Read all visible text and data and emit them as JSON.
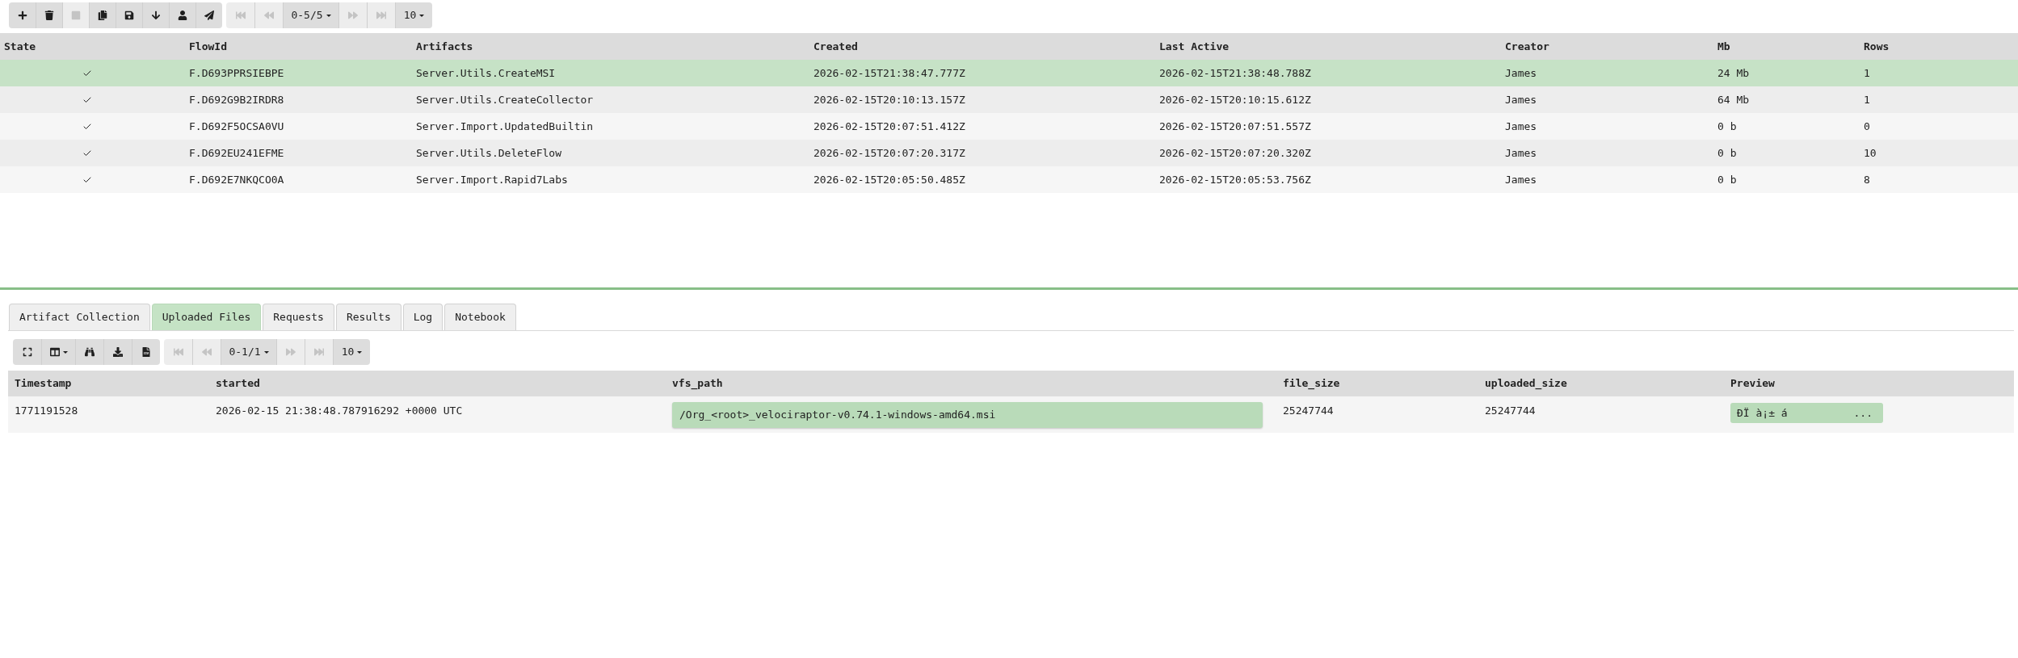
{
  "toolbar": {
    "buttons": [
      {
        "kind": "add",
        "disabled": false
      },
      {
        "kind": "delete",
        "disabled": false
      },
      {
        "kind": "stop",
        "disabled": true
      },
      {
        "kind": "copy",
        "disabled": false
      },
      {
        "kind": "save",
        "disabled": false
      },
      {
        "kind": "download_arrow",
        "disabled": false
      },
      {
        "kind": "user",
        "disabled": false
      },
      {
        "kind": "send",
        "disabled": false
      }
    ],
    "pager": [
      {
        "kind": "first",
        "disabled": true
      },
      {
        "kind": "prev",
        "disabled": true
      },
      {
        "kind": "range",
        "label": "0-5/5",
        "disabled": false
      },
      {
        "kind": "next",
        "disabled": true
      },
      {
        "kind": "last",
        "disabled": true
      },
      {
        "kind": "page_size",
        "label": "10",
        "disabled": false
      }
    ]
  },
  "flows": {
    "columns": [
      "State",
      "FlowId",
      "Artifacts",
      "Created",
      "Last Active",
      "Creator",
      "Mb",
      "Rows"
    ],
    "rows": [
      {
        "selected": true,
        "cells": [
          {
            "kind": "state",
            "completed": true
          },
          "F.D693PPRSIEBPE",
          "Server.Utils.CreateMSI",
          "2026-02-15T21:38:47.777Z",
          "2026-02-15T21:38:48.788Z",
          "James",
          "24 Mb",
          "1"
        ]
      },
      {
        "selected": false,
        "cells": [
          {
            "kind": "state",
            "completed": true
          },
          "F.D692G9B2IRDR8",
          "Server.Utils.CreateCollector",
          "2026-02-15T20:10:13.157Z",
          "2026-02-15T20:10:15.612Z",
          "James",
          "64 Mb",
          "1"
        ]
      },
      {
        "selected": false,
        "cells": [
          {
            "kind": "state",
            "completed": true
          },
          "F.D692F5OCSA0VU",
          "Server.Import.UpdatedBuiltin",
          "2026-02-15T20:07:51.412Z",
          "2026-02-15T20:07:51.557Z",
          "James",
          "0 b",
          "0"
        ]
      },
      {
        "selected": false,
        "cells": [
          {
            "kind": "state",
            "completed": true
          },
          "F.D692EU241EFME",
          "Server.Utils.DeleteFlow",
          "2026-02-15T20:07:20.317Z",
          "2026-02-15T20:07:20.320Z",
          "James",
          "0 b",
          "10"
        ]
      },
      {
        "selected": false,
        "cells": [
          {
            "kind": "state",
            "completed": true
          },
          "F.D692E7NKQCO0A",
          "Server.Import.Rapid7Labs",
          "2026-02-15T20:05:50.485Z",
          "2026-02-15T20:05:53.756Z",
          "James",
          "0 b",
          "8"
        ]
      }
    ]
  },
  "detail": {
    "tabs": [
      {
        "label": "Artifact Collection",
        "selected": false
      },
      {
        "label": "Uploaded Files",
        "selected": true
      },
      {
        "label": "Requests",
        "selected": false
      },
      {
        "label": "Results",
        "selected": false
      },
      {
        "label": "Log",
        "selected": false
      },
      {
        "label": "Notebook",
        "selected": false
      }
    ],
    "toolbar": {
      "buttons": [
        {
          "kind": "expand",
          "disabled": false
        },
        {
          "kind": "columns",
          "disabled": false
        },
        {
          "kind": "search",
          "disabled": false
        },
        {
          "kind": "download",
          "disabled": false
        },
        {
          "kind": "csv",
          "disabled": false
        }
      ],
      "pager": [
        {
          "kind": "first",
          "disabled": true
        },
        {
          "kind": "prev",
          "disabled": true
        },
        {
          "kind": "range",
          "label": "0-1/1",
          "disabled": false
        },
        {
          "kind": "next",
          "disabled": true
        },
        {
          "kind": "last",
          "disabled": true
        },
        {
          "kind": "page_size",
          "label": "10",
          "disabled": false
        }
      ]
    },
    "table": {
      "columns": [
        "Timestamp",
        "started",
        "vfs_path",
        "file_size",
        "uploaded_size",
        "Preview"
      ],
      "rows": [
        {
          "cells": [
            {
              "kind": "text",
              "text": "1771191528"
            },
            {
              "kind": "text",
              "text": "2026-02-15 21:38:48.787916292 +0000 UTC"
            },
            {
              "kind": "link",
              "text": "/Org_<root>_velociraptor-v0.74.1-windows-amd64.msi"
            },
            {
              "kind": "text",
              "text": "25247744"
            },
            {
              "kind": "text",
              "text": "25247744"
            },
            {
              "kind": "preview",
              "text": "ÐÏ à¡± á",
              "more": "..."
            }
          ]
        }
      ]
    }
  }
}
